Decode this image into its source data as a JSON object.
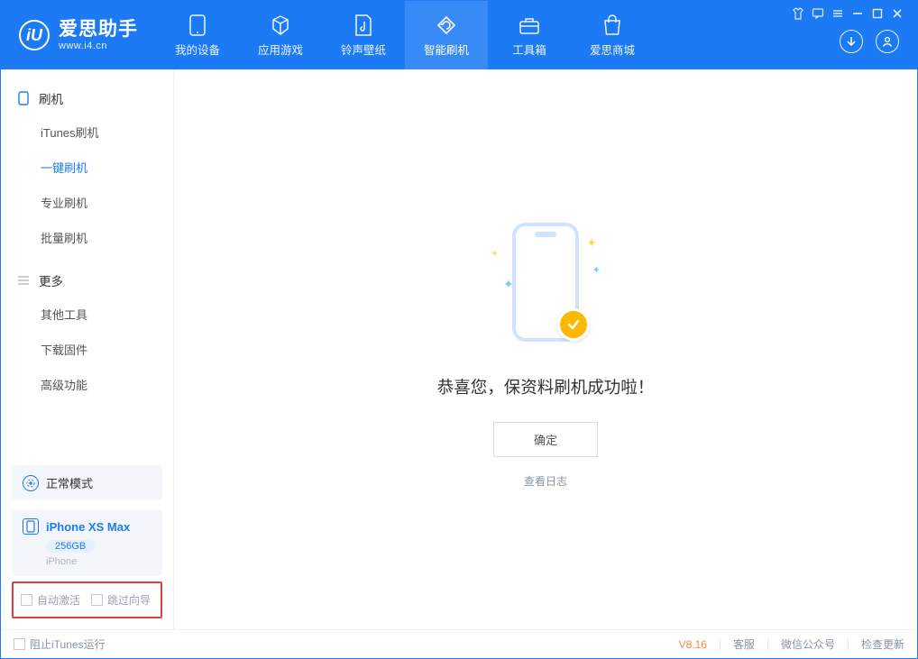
{
  "brand": {
    "title": "爱思助手",
    "subtitle": "www.i4.cn",
    "logo_letter": "iU"
  },
  "nav": {
    "items": [
      {
        "label": "我的设备"
      },
      {
        "label": "应用游戏"
      },
      {
        "label": "铃声壁纸"
      },
      {
        "label": "智能刷机"
      },
      {
        "label": "工具箱"
      },
      {
        "label": "爱思商城"
      }
    ],
    "active_index": 3
  },
  "sidebar": {
    "section1_label": "刷机",
    "section1_items": [
      {
        "label": "iTunes刷机"
      },
      {
        "label": "一键刷机"
      },
      {
        "label": "专业刷机"
      },
      {
        "label": "批量刷机"
      }
    ],
    "section1_active_index": 1,
    "section2_label": "更多",
    "section2_items": [
      {
        "label": "其他工具"
      },
      {
        "label": "下载固件"
      },
      {
        "label": "高级功能"
      }
    ]
  },
  "mode_card": {
    "label": "正常模式"
  },
  "device_card": {
    "name": "iPhone XS Max",
    "capacity": "256GB",
    "sub": "iPhone"
  },
  "checkboxes": {
    "auto_activate": "自动激活",
    "skip_guide": "跳过向导"
  },
  "main": {
    "success_title": "恭喜您，保资料刷机成功啦！",
    "ok_label": "确定",
    "log_link": "查看日志"
  },
  "statusbar": {
    "block_itunes": "阻止iTunes运行",
    "version": "V8.16",
    "links": [
      "客服",
      "微信公众号",
      "检查更新"
    ]
  }
}
